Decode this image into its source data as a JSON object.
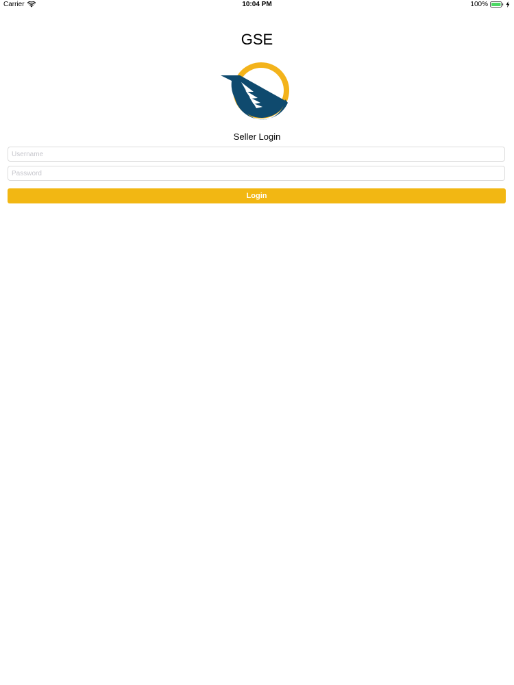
{
  "status_bar": {
    "carrier": "Carrier",
    "time": "10:04 PM",
    "battery_percent": "100%",
    "wifi_icon": "wifi-icon",
    "battery_icon": "battery-icon",
    "battery_level": 1.0,
    "charging_icon": "bolt-icon"
  },
  "app": {
    "title": "GSE",
    "logo_icon": "gse-logo"
  },
  "login": {
    "heading": "Seller Login",
    "username_placeholder": "Username",
    "username_value": "",
    "password_placeholder": "Password",
    "password_value": "",
    "button_label": "Login"
  },
  "colors": {
    "accent": "#f2b713",
    "logo_navy": "#0f4a6e",
    "logo_gold": "#f3b31b",
    "battery_green": "#4cd964",
    "field_border": "#dcdcdc",
    "placeholder": "#c7c7cd"
  }
}
